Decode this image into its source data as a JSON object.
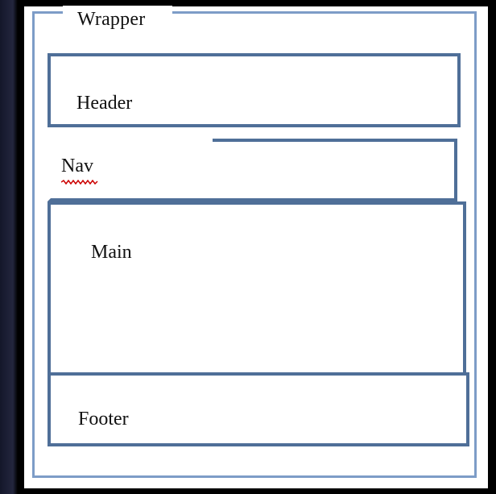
{
  "diagram": {
    "wrapper_label": "Wrapper",
    "header_label": "Header",
    "nav_label": "Nav",
    "main_label": "Main",
    "footer_label": "Footer"
  },
  "colors": {
    "box_border": "#4f6f98",
    "wrapper_border": "#7d9cc7",
    "spellcheck_underline": "#cc0000",
    "background": "#000000"
  }
}
